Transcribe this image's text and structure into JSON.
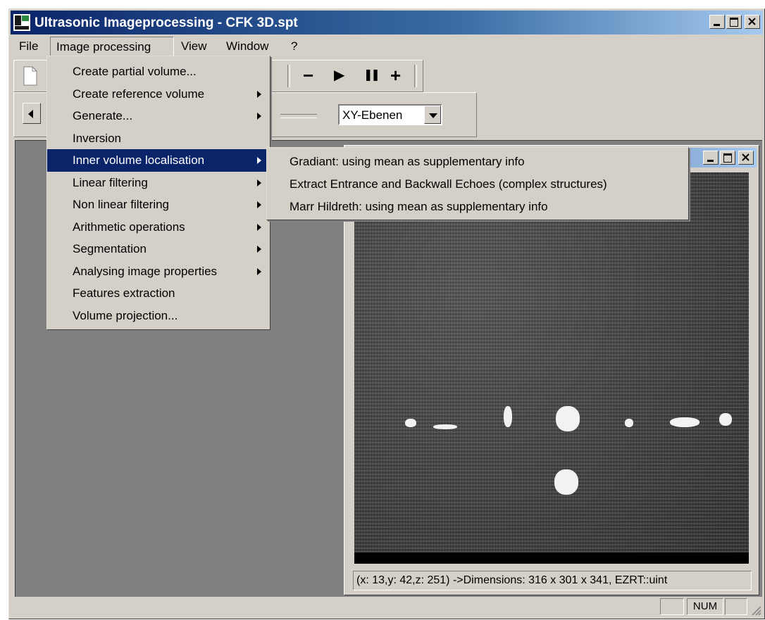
{
  "window": {
    "title": "Ultrasonic Imageprocessing - CFK 3D.spt",
    "caption_buttons": [
      "minimize-icon",
      "maximize-icon",
      "close-icon"
    ]
  },
  "menubar": {
    "file": "File",
    "image_processing": "Image processing",
    "view": "View",
    "window": "Window",
    "help": "?"
  },
  "toolbar": {
    "minus": "−",
    "play": "▶",
    "pause": "❚❚",
    "plus": "+",
    "prev": "◀"
  },
  "plane_select": {
    "value": "XY-Ebenen"
  },
  "image_menu": {
    "items": [
      {
        "label": "Create partial volume...",
        "submenu": false
      },
      {
        "label": "Create reference volume",
        "submenu": true
      },
      {
        "label": "Generate...",
        "submenu": true
      },
      {
        "label": "Inversion",
        "submenu": false
      },
      {
        "label": "Inner volume localisation",
        "submenu": true,
        "highlighted": true
      },
      {
        "label": "Linear filtering",
        "submenu": true
      },
      {
        "label": "Non linear filtering",
        "submenu": true
      },
      {
        "label": "Arithmetic operations",
        "submenu": true
      },
      {
        "label": "Segmentation",
        "submenu": true
      },
      {
        "label": "Analysing image properties",
        "submenu": true
      },
      {
        "label": "Features extraction",
        "submenu": false
      },
      {
        "label": "Volume projection...",
        "submenu": false
      }
    ]
  },
  "inner_volume_submenu": {
    "items": [
      "Gradiant: using mean as supplementary info",
      "Extract Entrance and Backwall Echoes (complex structures)",
      "Marr Hildreth: using mean as supplementary info"
    ]
  },
  "child_window": {
    "status": "(x: 13,y: 42,z: 251) ->Dimensions: 316 x 301 x 341, EZRT::uint"
  },
  "statusbar": {
    "num": "NUM"
  },
  "colors": {
    "title_active": "#0a246a",
    "menu_highlight": "#0a246a",
    "face": "#d4d0c8",
    "mdi_background": "#808080"
  }
}
